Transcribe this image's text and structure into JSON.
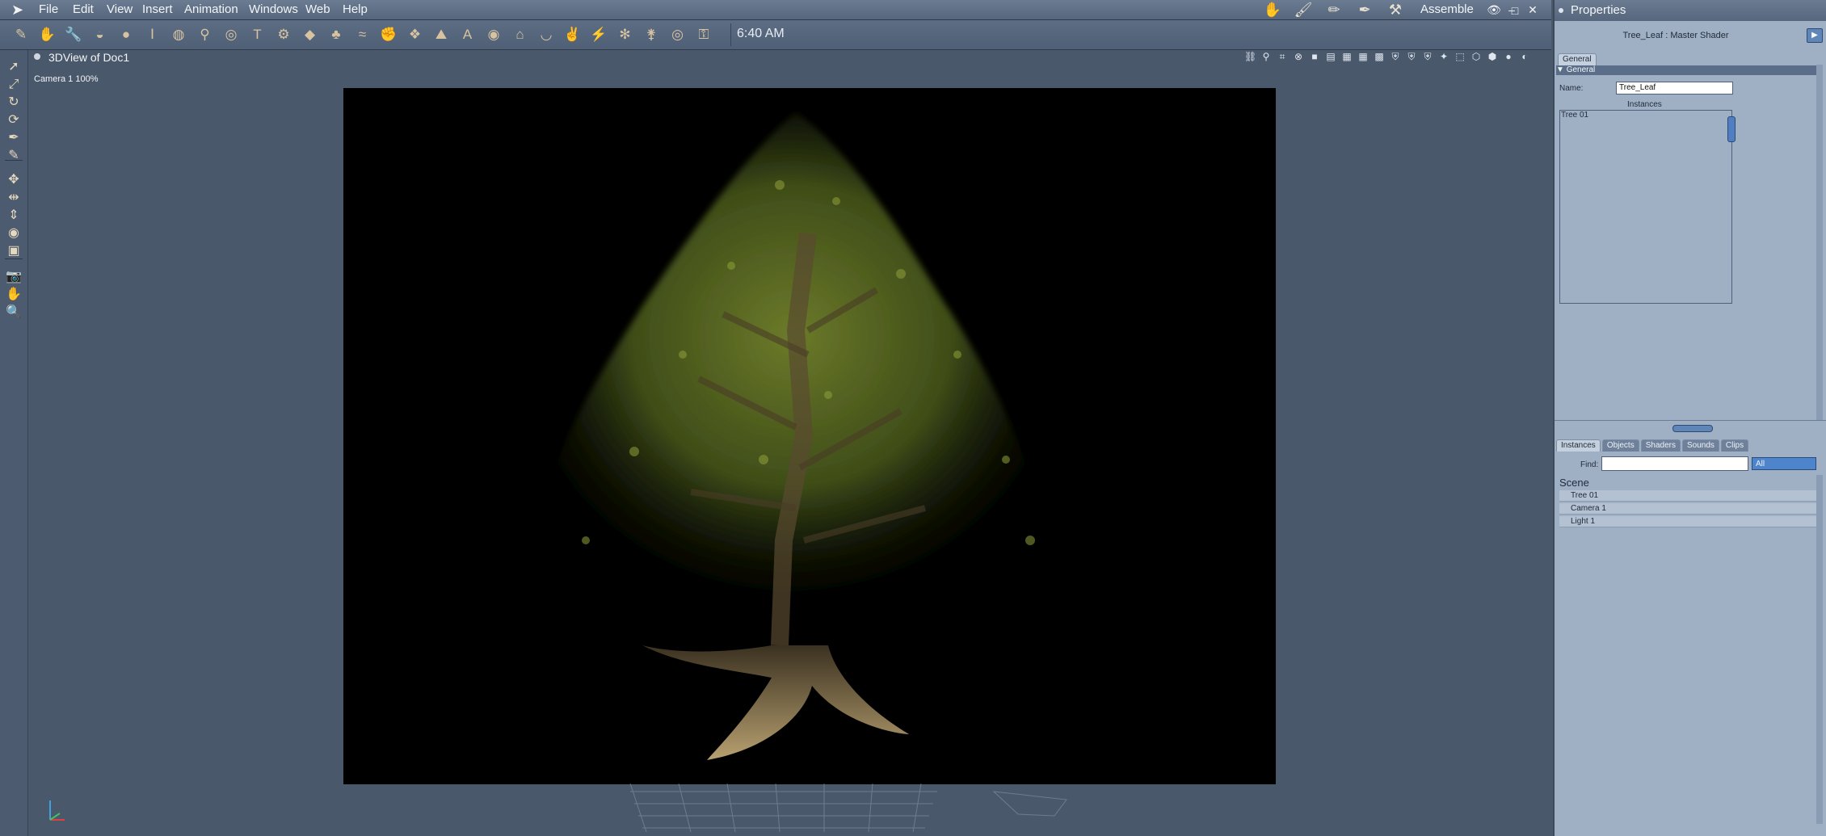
{
  "menubar": {
    "items": [
      "File",
      "Edit",
      "View",
      "Insert",
      "Animation",
      "Windows",
      "Web",
      "Help"
    ],
    "workspace": "Assemble",
    "right_icons": [
      "hand-icon",
      "brush-icon",
      "pencil-icon",
      "pen-icon",
      "wrench-icon"
    ]
  },
  "toolbar": {
    "clock": "6:40 AM",
    "tools": [
      "paint-icon",
      "hand-icon",
      "wrench-icon",
      "bridge-icon",
      "sphere-icon",
      "column-icon",
      "globe-icon",
      "bone-icon",
      "torus-icon",
      "text-t-icon",
      "gear-icon",
      "plane-icon",
      "tree-icon",
      "drape-icon",
      "hand-pose-icon",
      "cluster-icon",
      "terrain-icon",
      "agi-icon",
      "donut-icon",
      "house-icon",
      "bowl-icon",
      "glove-icon",
      "wand-icon",
      "bug-icon",
      "stick-figure-icon",
      "target-icon",
      "key-icon"
    ]
  },
  "left_tools": [
    "select-arrow-icon",
    "scale-icon",
    "rotate-icon",
    "twist-icon",
    "pen-tool-icon",
    "paint-tool-icon",
    "move-xyz-icon",
    "move-xz-icon",
    "move-y-icon",
    "orbit-icon",
    "box-shader-icon",
    "camera-icon",
    "pan-hand-icon",
    "zoom-icon"
  ],
  "view": {
    "title": "3DView of Doc1",
    "camera_label": "Camera 1 100%",
    "header_icons": [
      "link-icon",
      "pin-icon",
      "grid-icon",
      "target-icon",
      "single-view-icon",
      "two-view-icon",
      "three-view-icon",
      "four-view-icon",
      "quad-view-icon",
      "shield-icon",
      "shield-icon",
      "shield-icon",
      "compass-icon",
      "dotted-box-icon",
      "cube-icon",
      "cube-shaded-icon",
      "sphere-white-icon",
      "sphere-gray-icon"
    ]
  },
  "properties": {
    "title": "Properties",
    "subtitle": "Tree_Leaf : Master Shader",
    "tab": "General",
    "section": "General",
    "name_label": "Name:",
    "name_value": "Tree_Leaf",
    "instances_label": "Instances",
    "instances": [
      "Tree 01"
    ]
  },
  "library": {
    "tabs": [
      "Instances",
      "Objects",
      "Shaders",
      "Sounds",
      "Clips"
    ],
    "find_label": "Find:",
    "find_value": "",
    "filter_value": "All",
    "scene_header": "Scene",
    "scene_items": [
      "Tree 01",
      "Camera 1",
      "Light 1"
    ]
  },
  "colors": {
    "ui_background": "#4a586c",
    "panel_background": "#9fb0c5",
    "render_background": "#000000",
    "accent_blue": "#4e84cc"
  }
}
